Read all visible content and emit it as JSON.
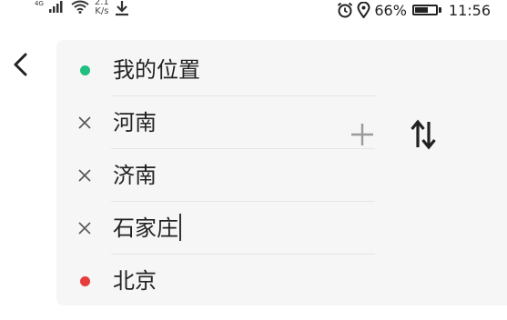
{
  "status_bar": {
    "network_type": "4G",
    "speed_value": "2.1",
    "speed_unit": "K/s",
    "battery_percent": "66%",
    "battery_level": 0.66,
    "time": "11:56",
    "icons": [
      "signal-icon",
      "wifi-icon",
      "download-icon",
      "alarm-icon",
      "location-icon",
      "battery-icon"
    ]
  },
  "route": {
    "stops": [
      {
        "label": "我的位置",
        "marker": "dot",
        "color": "#1fbf7f"
      },
      {
        "label": "河南",
        "marker": "remove-icon"
      },
      {
        "label": "济南",
        "marker": "remove-icon"
      },
      {
        "label": "石家庄",
        "marker": "remove-icon",
        "editing": true
      },
      {
        "label": "北京",
        "marker": "dot",
        "color": "#e63c3c"
      }
    ]
  },
  "colors": {
    "start_dot": "#1fbf7f",
    "end_dot": "#e63c3c",
    "icon_gray": "#9a9a9a",
    "card_background": "#f6f6f6"
  }
}
